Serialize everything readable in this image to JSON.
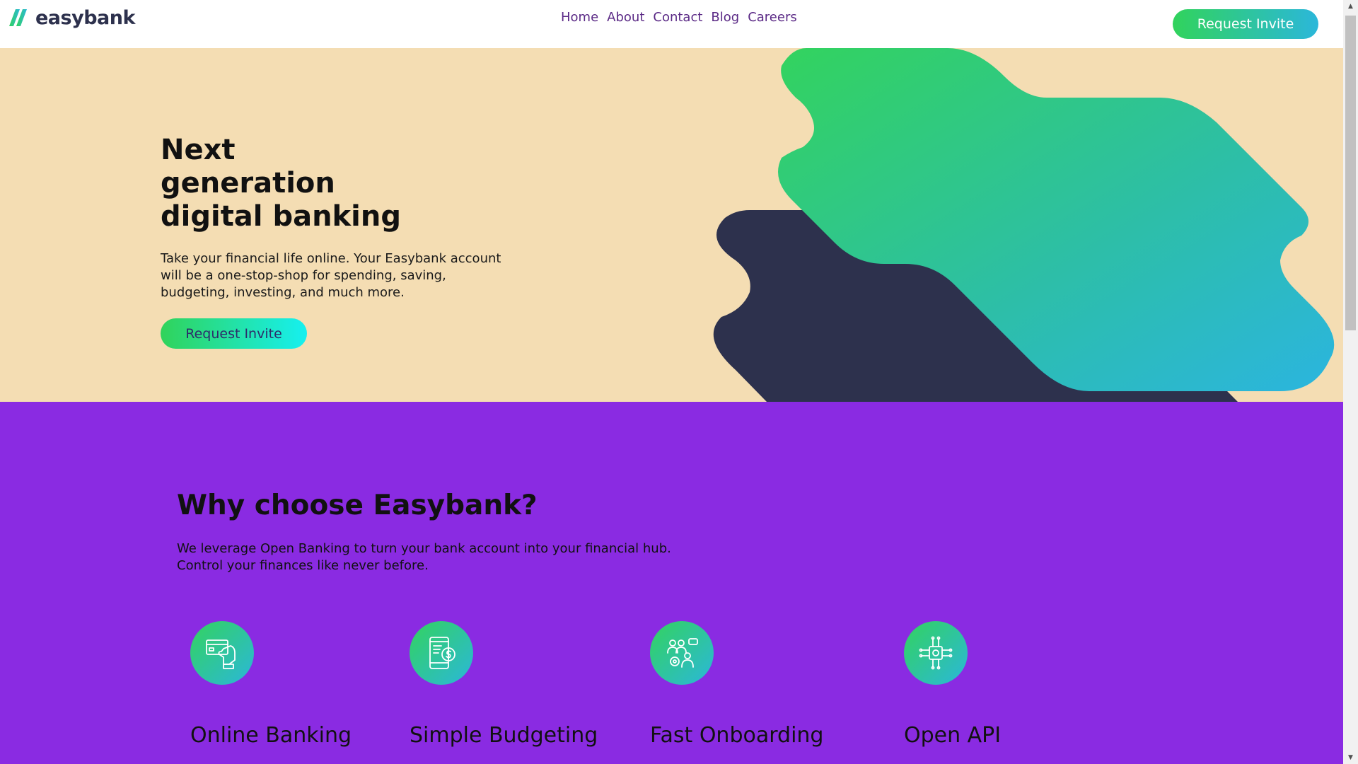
{
  "brand": {
    "name": "easybank",
    "colors": {
      "green": "#31d35c",
      "cyan": "#2bb7da",
      "navy": "#2d314d",
      "hero_bg": "#f4ddb3",
      "section_bg": "#8a2be2"
    }
  },
  "nav": {
    "items": [
      "Home",
      "About",
      "Contact",
      "Blog",
      "Careers"
    ]
  },
  "header": {
    "cta_label": "Request Invite"
  },
  "hero": {
    "title_line1": "Next generation",
    "title_line2": "digital banking",
    "description": "Take your financial life online. Your Easybank account will be a one-stop-shop for spending, saving, budgeting, investing, and much more.",
    "cta_label": "Request Invite"
  },
  "why": {
    "title": "Why choose Easybank?",
    "description_line1": "We leverage Open Banking to turn your bank account into your financial hub.",
    "description_line2": "Control your finances like never before.",
    "features": [
      {
        "title": "Online Banking",
        "icon": "card-in-hand-icon"
      },
      {
        "title": "Simple Budgeting",
        "icon": "phone-budget-icon"
      },
      {
        "title": "Fast Onboarding",
        "icon": "team-onboarding-icon"
      },
      {
        "title": "Open API",
        "icon": "chip-api-icon"
      }
    ]
  }
}
